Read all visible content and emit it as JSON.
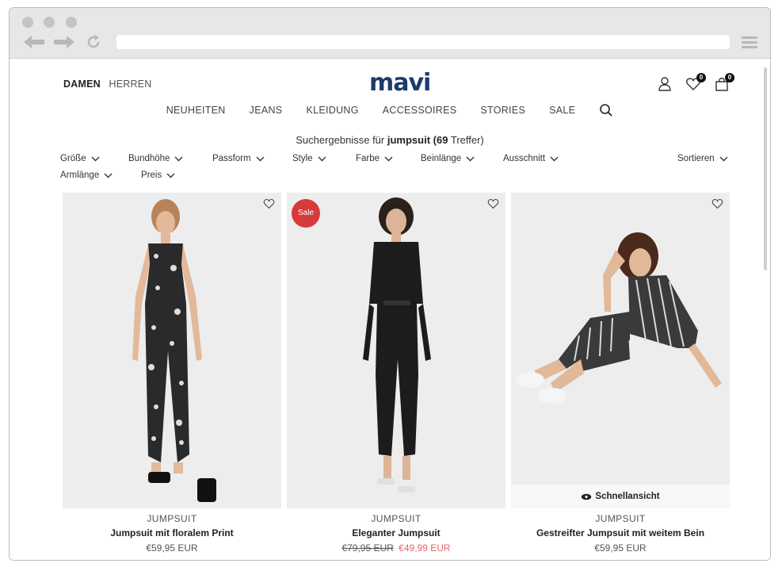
{
  "header": {
    "gender_tabs": [
      "DAMEN",
      "HERREN"
    ],
    "logo": "mavi",
    "wishlist_count": "0",
    "cart_count": "0"
  },
  "nav": {
    "items": [
      "NEUHEITEN",
      "JEANS",
      "KLEIDUNG",
      "ACCESSOIRES",
      "STORIES",
      "SALE"
    ]
  },
  "results": {
    "prefix": "Suchergebnisse für",
    "query": "jumpsuit",
    "count": "(69",
    "suffix": "Treffer)"
  },
  "filters": [
    "Größe",
    "Bundhöhe",
    "Passform",
    "Style",
    "Farbe",
    "Beinlänge",
    "Ausschnitt",
    "Armlänge",
    "Preis"
  ],
  "sort_label": "Sortieren",
  "products": [
    {
      "category": "JUMPSUIT",
      "name": "Jumpsuit mit floralem Print",
      "price": "€59,95 EUR",
      "old_price": "",
      "sale_price": "",
      "sale_badge": ""
    },
    {
      "category": "JUMPSUIT",
      "name": "Eleganter Jumpsuit",
      "price": "",
      "old_price": "€79,95 EUR",
      "sale_price": "€49,99 EUR",
      "sale_badge": "Sale"
    },
    {
      "category": "JUMPSUIT",
      "name": "Gestreifter Jumpsuit mit weitem Bein",
      "price": "€59,95 EUR",
      "old_price": "",
      "sale_price": "",
      "sale_badge": "",
      "quickview": "Schnellansicht"
    }
  ],
  "colors": {
    "brand": "#1c3b6e",
    "sale": "#d63a3a",
    "sale_price": "#e06a6a"
  }
}
